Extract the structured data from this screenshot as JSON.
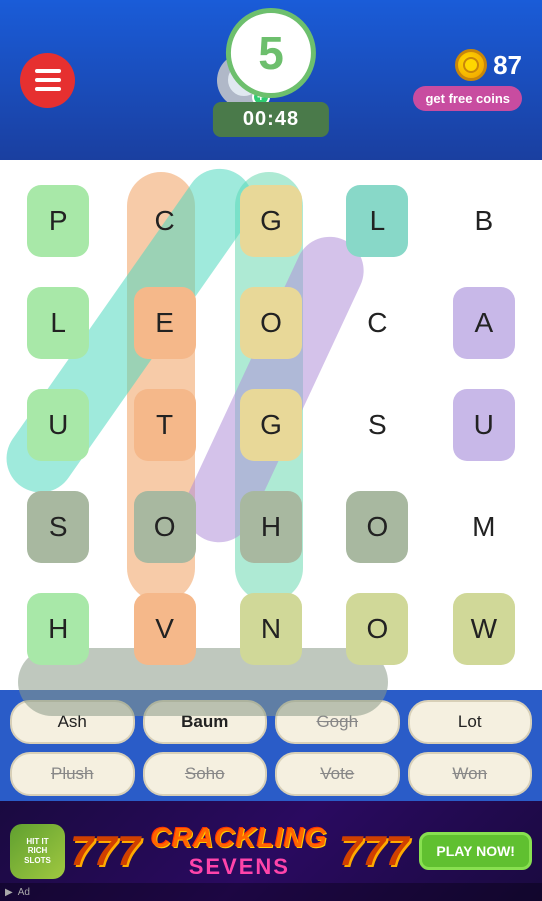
{
  "header": {
    "score": "5",
    "timer": "00:48",
    "coins": "87",
    "get_free_label": "get free coins"
  },
  "grid": {
    "cells": [
      {
        "letter": "P",
        "bg": "green"
      },
      {
        "letter": "C",
        "bg": "none"
      },
      {
        "letter": "G",
        "bg": "yellow"
      },
      {
        "letter": "L",
        "bg": "teal"
      },
      {
        "letter": "B",
        "bg": "none"
      },
      {
        "letter": "L",
        "bg": "green"
      },
      {
        "letter": "E",
        "bg": "orange"
      },
      {
        "letter": "O",
        "bg": "yellow"
      },
      {
        "letter": "C",
        "bg": "none"
      },
      {
        "letter": "A",
        "bg": "purple"
      },
      {
        "letter": "U",
        "bg": "green"
      },
      {
        "letter": "T",
        "bg": "orange"
      },
      {
        "letter": "G",
        "bg": "yellow"
      },
      {
        "letter": "S",
        "bg": "none"
      },
      {
        "letter": "U",
        "bg": "purple"
      },
      {
        "letter": "S",
        "bg": "gray"
      },
      {
        "letter": "O",
        "bg": "gray"
      },
      {
        "letter": "H",
        "bg": "gray"
      },
      {
        "letter": "O",
        "bg": "gray"
      },
      {
        "letter": "M",
        "bg": "none"
      },
      {
        "letter": "H",
        "bg": "green"
      },
      {
        "letter": "V",
        "bg": "orange"
      },
      {
        "letter": "N",
        "bg": "olive"
      },
      {
        "letter": "O",
        "bg": "olive"
      },
      {
        "letter": "W",
        "bg": "olive"
      }
    ]
  },
  "words": {
    "row1": [
      {
        "text": "Ash",
        "state": "normal"
      },
      {
        "text": "Baum",
        "state": "found"
      },
      {
        "text": "Gogh",
        "state": "strikethrough"
      },
      {
        "text": "Lot",
        "state": "normal"
      }
    ],
    "row2": [
      {
        "text": "Plush",
        "state": "strikethrough"
      },
      {
        "text": "Soho",
        "state": "strikethrough"
      },
      {
        "text": "Vote",
        "state": "strikethrough"
      },
      {
        "text": "Won",
        "state": "strikethrough"
      }
    ]
  },
  "ad": {
    "logo_text": "HIT IT RICH",
    "seven_symbol": "777",
    "title_line1": "CRACKLING",
    "title_line2": "SEVENS",
    "play_now_label": "PLAY NOW!",
    "ad_label": "Ad",
    "arrow": "▶"
  }
}
